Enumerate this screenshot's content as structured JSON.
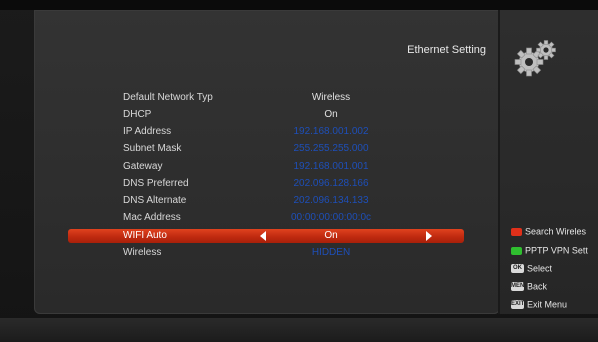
{
  "header": {
    "title": "Ethernet Setting"
  },
  "icons": {
    "settings": "gears-icon"
  },
  "settings": [
    {
      "label": "Default Network Typ",
      "value": "Wireless",
      "value_color": "light"
    },
    {
      "label": "DHCP",
      "value": "On",
      "value_color": "light"
    },
    {
      "label": "IP Address",
      "value": "192.168.001.002",
      "value_color": "blue"
    },
    {
      "label": "Subnet Mask",
      "value": "255.255.255.000",
      "value_color": "blue"
    },
    {
      "label": "Gateway",
      "value": "192.168.001.001",
      "value_color": "blue"
    },
    {
      "label": "DNS Preferred",
      "value": "202.096.128.166",
      "value_color": "blue"
    },
    {
      "label": "DNS Alternate",
      "value": "202.096.134.133",
      "value_color": "blue"
    },
    {
      "label": "Mac Address",
      "value": "00:00:00:00:00:0c",
      "value_color": "blue"
    },
    {
      "label": "WIFI Auto",
      "value": "On",
      "value_color": "light",
      "selected": true
    },
    {
      "label": "Wireless",
      "value": "HIDDEN",
      "value_color": "blue"
    }
  ],
  "legend": {
    "red": "Search Wireles",
    "green": "PPTP VPN Sett",
    "select_key": "OK",
    "select": "Select",
    "menu_key": "MENU",
    "back": "Back",
    "exit_key": "EXIT",
    "exit": "Exit Menu"
  },
  "colors": {
    "selected_row": "#d2371a",
    "value_blue": "#1e4fb8",
    "key_red": "#e0301a",
    "key_green": "#2fbf2f"
  }
}
